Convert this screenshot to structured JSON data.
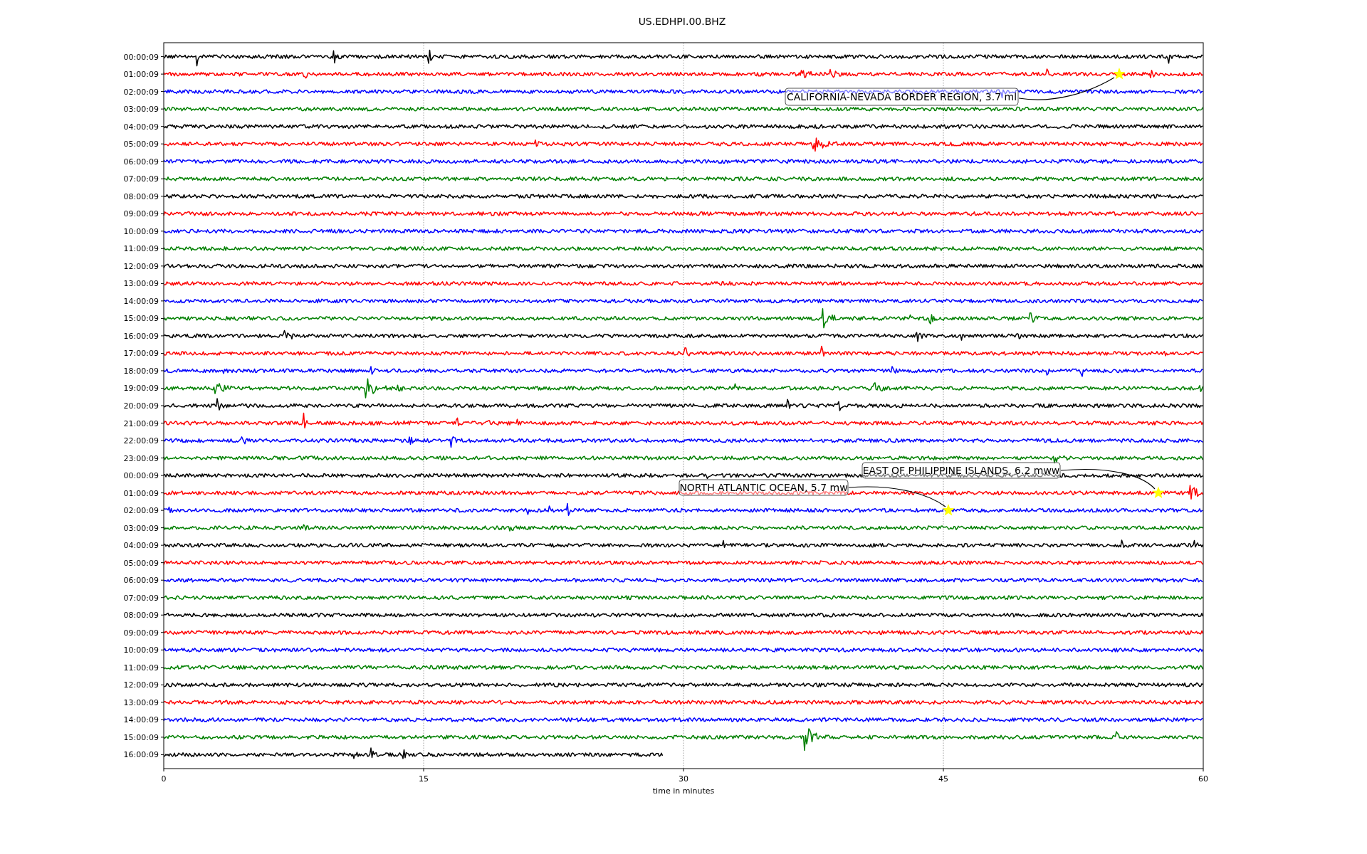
{
  "title": "US.EDHPI.00.BHZ",
  "traces": [
    {
      "time": "00:00:09",
      "color": "#000000",
      "partial": false
    },
    {
      "time": "01:00:09",
      "color": "#ff0000",
      "partial": false
    },
    {
      "time": "02:00:09",
      "color": "#0000ff",
      "partial": false
    },
    {
      "time": "03:00:09",
      "color": "#008000",
      "partial": false
    },
    {
      "time": "04:00:09",
      "color": "#000000",
      "partial": false
    },
    {
      "time": "05:00:09",
      "color": "#ff0000",
      "partial": false
    },
    {
      "time": "06:00:09",
      "color": "#0000ff",
      "partial": false
    },
    {
      "time": "07:00:09",
      "color": "#008000",
      "partial": false
    },
    {
      "time": "08:00:09",
      "color": "#000000",
      "partial": false
    },
    {
      "time": "09:00:09",
      "color": "#ff0000",
      "partial": false
    },
    {
      "time": "10:00:09",
      "color": "#0000ff",
      "partial": false
    },
    {
      "time": "11:00:09",
      "color": "#008000",
      "partial": false
    },
    {
      "time": "12:00:09",
      "color": "#000000",
      "partial": false
    },
    {
      "time": "13:00:09",
      "color": "#ff0000",
      "partial": false
    },
    {
      "time": "14:00:09",
      "color": "#0000ff",
      "partial": false
    },
    {
      "time": "15:00:09",
      "color": "#008000",
      "partial": false
    },
    {
      "time": "16:00:09",
      "color": "#000000",
      "partial": false
    },
    {
      "time": "17:00:09",
      "color": "#ff0000",
      "partial": false
    },
    {
      "time": "18:00:09",
      "color": "#0000ff",
      "partial": false
    },
    {
      "time": "19:00:09",
      "color": "#008000",
      "partial": false
    },
    {
      "time": "20:00:09",
      "color": "#000000",
      "partial": false
    },
    {
      "time": "21:00:09",
      "color": "#ff0000",
      "partial": false
    },
    {
      "time": "22:00:09",
      "color": "#0000ff",
      "partial": false
    },
    {
      "time": "23:00:09",
      "color": "#008000",
      "partial": false
    },
    {
      "time": "00:00:09",
      "color": "#000000",
      "partial": false
    },
    {
      "time": "01:00:09",
      "color": "#ff0000",
      "partial": false
    },
    {
      "time": "02:00:09",
      "color": "#0000ff",
      "partial": false
    },
    {
      "time": "03:00:09",
      "color": "#008000",
      "partial": false
    },
    {
      "time": "04:00:09",
      "color": "#000000",
      "partial": false
    },
    {
      "time": "05:00:09",
      "color": "#ff0000",
      "partial": false
    },
    {
      "time": "06:00:09",
      "color": "#0000ff",
      "partial": false
    },
    {
      "time": "07:00:09",
      "color": "#008000",
      "partial": false
    },
    {
      "time": "08:00:09",
      "color": "#000000",
      "partial": false
    },
    {
      "time": "09:00:09",
      "color": "#ff0000",
      "partial": false
    },
    {
      "time": "10:00:09",
      "color": "#0000ff",
      "partial": false
    },
    {
      "time": "11:00:09",
      "color": "#008000",
      "partial": false
    },
    {
      "time": "12:00:09",
      "color": "#000000",
      "partial": false
    },
    {
      "time": "13:00:09",
      "color": "#ff0000",
      "partial": false
    },
    {
      "time": "14:00:09",
      "color": "#0000ff",
      "partial": false
    },
    {
      "time": "15:00:09",
      "color": "#008000",
      "partial": false
    },
    {
      "time": "16:00:09",
      "color": "#000000",
      "partial": true
    }
  ],
  "x_axis": {
    "label": "time in minutes",
    "ticks": [
      "0",
      "15",
      "30",
      "45",
      "60"
    ]
  },
  "events": [
    {
      "label": "CALIFORNIA-NEVADA BORDER REGION, 3.7 ml"
    },
    {
      "label": "EAST OF PHILIPPINE ISLANDS, 6.2 mww"
    },
    {
      "label": "NORTH ATLANTIC OCEAN, 5.7 mw"
    }
  ]
}
